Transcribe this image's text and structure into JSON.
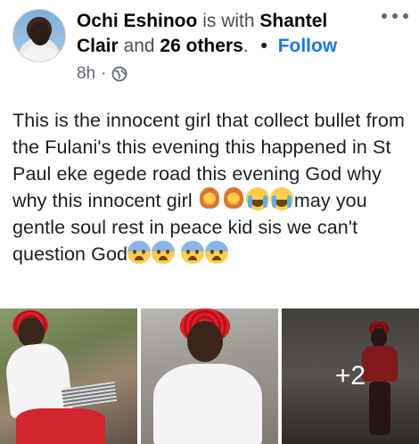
{
  "header": {
    "author": "Ochi Eshinoo",
    "is_with": "is with",
    "tagged_name": "Shantel Clair",
    "and_text": "and",
    "others": "26 others",
    "period": ".",
    "dot": "•",
    "follow_label": "Follow",
    "time": "8h",
    "separator": "·",
    "privacy_icon": "globe-icon",
    "more_icon": "more-options-icon"
  },
  "post": {
    "text_1": "This is the innocent girl that collect bullet from the Fulani's this evening this happened in St Paul eke egede road this evening God why why this innocent girl ",
    "text_2": "may you gentle soul rest in peace kid sis we can't question God",
    "emojis_1": [
      "woman-gesturing-emoji",
      "woman-gesturing-emoji",
      "loudly-crying-emoji",
      "loudly-crying-emoji"
    ],
    "emojis_2": [
      "fearful-face-emoji",
      "fearful-face-emoji",
      "fearful-face-emoji",
      "fearful-face-emoji"
    ]
  },
  "gallery": {
    "extra_count": "+2"
  },
  "colors": {
    "link": "#1877f2",
    "muted": "#606770",
    "text": "#1c1e21"
  }
}
